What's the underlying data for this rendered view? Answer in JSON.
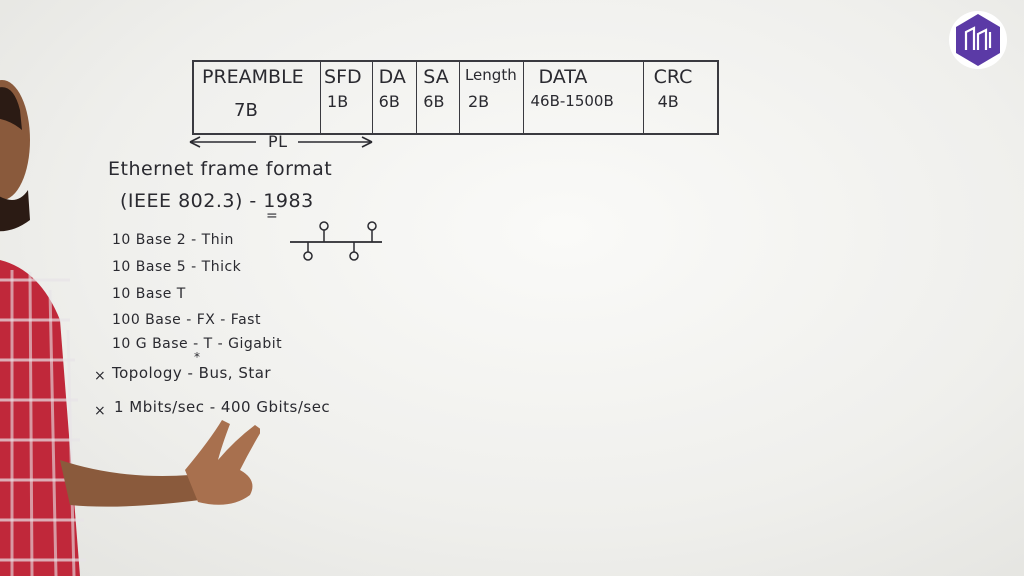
{
  "frame_table": [
    {
      "field": "PREAMBLE",
      "size": "7B"
    },
    {
      "field": "SFD",
      "size": "1B"
    },
    {
      "field": "DA",
      "size": "6B"
    },
    {
      "field": "SA",
      "size": "6B"
    },
    {
      "field": "Length",
      "size": "2B"
    },
    {
      "field": "DATA",
      "size": "46B-1500B"
    },
    {
      "field": "CRC",
      "size": "4B"
    }
  ],
  "pl_label": "PL",
  "heading": "Ethernet frame format",
  "standard": "(IEEE 802.3) - 1983",
  "variants": [
    "10 Base 2 - Thin",
    "10 Base 5 - Thick",
    "10 Base T",
    "100 Base - FX - Fast",
    "10 G Base - T - Gigabit"
  ],
  "notes": [
    "Topology - Bus, Star",
    "1 Mbits/sec - 400 Gbits/sec"
  ],
  "bullet_mark": "×",
  "colors": {
    "ink": "#2a2a30",
    "logo_bg": "#5b3aa6",
    "shirt": "#c0283a"
  },
  "logo_icon": "brand-logo-icon"
}
